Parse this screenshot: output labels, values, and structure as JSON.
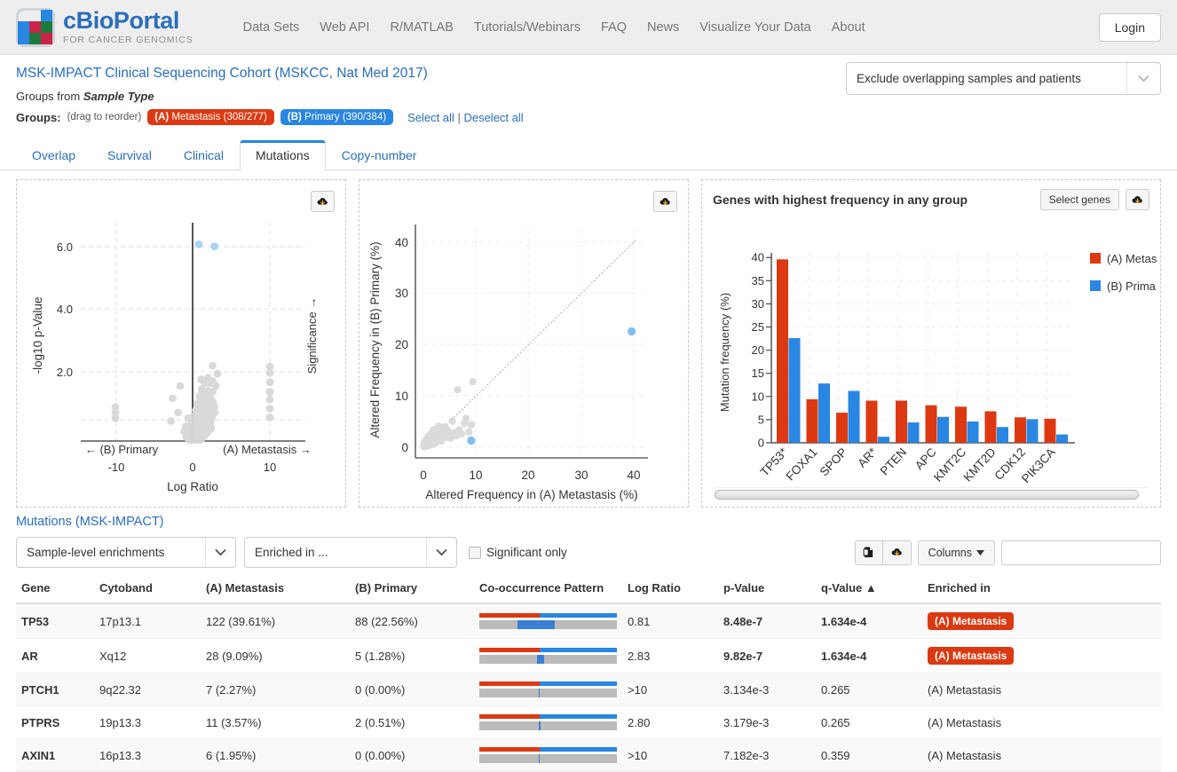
{
  "nav": {
    "logo_title": "cBioPortal",
    "logo_sub": "FOR CANCER GENOMICS",
    "links": [
      "Data Sets",
      "Web API",
      "R/MATLAB",
      "Tutorials/Webinars",
      "FAQ",
      "News",
      "Visualize Your Data",
      "About"
    ],
    "login_label": "Login"
  },
  "study": {
    "title": "MSK-IMPACT Clinical Sequencing Cohort (MSKCC, Nat Med 2017)",
    "groups_from_prefix": "Groups from ",
    "groups_from_attr": "Sample Type",
    "groups_label": "Groups:",
    "drag_hint": "(drag to reorder)",
    "group_a": "(A) Metastasis (308/277)",
    "group_a_prefix": "(A)",
    "group_a_rest": " Metastasis (308/277)",
    "group_b_prefix": "(B)",
    "group_b_rest": " Primary (390/384)",
    "select_all": "Select all",
    "separator": "|",
    "deselect_all": "Deselect all",
    "cohort_select_value": "Exclude overlapping samples and patients"
  },
  "tabs": [
    {
      "label": "Overlap",
      "active": false
    },
    {
      "label": "Survival",
      "active": false
    },
    {
      "label": "Clinical",
      "active": false
    },
    {
      "label": "Mutations",
      "active": true
    },
    {
      "label": "Copy-number",
      "active": false
    }
  ],
  "panels": {
    "bar_title": "Genes with highest frequency in any group",
    "select_genes_label": "Select genes"
  },
  "chart_data": [
    {
      "type": "scatter",
      "name": "volcano-plot",
      "title": "",
      "xlabel": "Log Ratio",
      "ylabel": "-log10 p-Value",
      "ylabel_right": "Significance →",
      "xaxis_left_label": "← (B) Primary",
      "xaxis_right_label": "(A) Metastasis →",
      "xticks": [
        -10,
        0,
        10
      ],
      "xticklabels": [
        "-10",
        "0",
        "10"
      ],
      "yticks": [
        2.0,
        4.0,
        6.0
      ],
      "yticklabels": [
        "2.0",
        "4.0",
        "6.0"
      ],
      "xlim": [
        -15,
        15
      ],
      "ylim": [
        0,
        7
      ],
      "grid": true,
      "highlight_color": "#a8d4f5",
      "point_color": "#d8d8d8",
      "highlighted_points": [
        {
          "x": 0.81,
          "y": 6.07
        },
        {
          "x": 2.83,
          "y": 6.01
        }
      ],
      "points": [
        {
          "x": -10,
          "y": 1.05
        },
        {
          "x": -10,
          "y": 0.88
        },
        {
          "x": -10,
          "y": 0.7
        },
        {
          "x": 10,
          "y": 2.3
        },
        {
          "x": 10,
          "y": 2.1
        },
        {
          "x": 10,
          "y": 1.82
        },
        {
          "x": 10,
          "y": 1.52
        },
        {
          "x": 10,
          "y": 1.5
        },
        {
          "x": 10,
          "y": 1.28
        },
        {
          "x": 10,
          "y": 1.0
        },
        {
          "x": 10,
          "y": 0.73
        },
        {
          "x": 2.6,
          "y": 2.33
        },
        {
          "x": 3.2,
          "y": 2.08
        },
        {
          "x": 2.0,
          "y": 1.95
        },
        {
          "x": 1.1,
          "y": 1.9
        },
        {
          "x": 2.6,
          "y": 1.85
        },
        {
          "x": 1.6,
          "y": 1.8
        },
        {
          "x": 2.2,
          "y": 1.78
        },
        {
          "x": 3.0,
          "y": 1.7
        },
        {
          "x": -1.6,
          "y": 1.7
        },
        {
          "x": 1.2,
          "y": 1.6
        },
        {
          "x": 2.0,
          "y": 1.55
        },
        {
          "x": 2.6,
          "y": 1.52
        },
        {
          "x": 1.5,
          "y": 1.45
        },
        {
          "x": 0.9,
          "y": 1.4
        },
        {
          "x": 2.3,
          "y": 1.37
        },
        {
          "x": -2.6,
          "y": 1.32
        },
        {
          "x": 1.0,
          "y": 1.28
        },
        {
          "x": 1.9,
          "y": 1.25
        },
        {
          "x": 2.6,
          "y": 1.22
        },
        {
          "x": 1.4,
          "y": 1.18
        },
        {
          "x": 0.6,
          "y": 1.15
        },
        {
          "x": 2.1,
          "y": 1.12
        },
        {
          "x": 2.8,
          "y": 1.08
        },
        {
          "x": 1.0,
          "y": 1.05
        },
        {
          "x": 1.7,
          "y": 1.02
        },
        {
          "x": 2.4,
          "y": 0.98
        },
        {
          "x": 0.4,
          "y": 0.95
        },
        {
          "x": 1.2,
          "y": 0.92
        },
        {
          "x": 2.0,
          "y": 0.9
        },
        {
          "x": 2.9,
          "y": 0.88
        },
        {
          "x": -1.9,
          "y": 0.88
        },
        {
          "x": 0.8,
          "y": 0.85
        },
        {
          "x": 1.5,
          "y": 0.82
        },
        {
          "x": 2.3,
          "y": 0.8
        },
        {
          "x": 0.2,
          "y": 0.78
        },
        {
          "x": 1.0,
          "y": 0.75
        },
        {
          "x": 1.8,
          "y": 0.73
        },
        {
          "x": 2.5,
          "y": 0.7
        },
        {
          "x": -0.6,
          "y": 0.7
        },
        {
          "x": 0.5,
          "y": 0.67
        },
        {
          "x": 1.3,
          "y": 0.65
        },
        {
          "x": 2.0,
          "y": 0.62
        },
        {
          "x": -2.8,
          "y": 0.62
        },
        {
          "x": 0.1,
          "y": 0.6
        },
        {
          "x": 0.9,
          "y": 0.58
        },
        {
          "x": 1.6,
          "y": 0.56
        },
        {
          "x": 2.3,
          "y": 0.54
        },
        {
          "x": -0.3,
          "y": 0.52
        },
        {
          "x": 0.6,
          "y": 0.5
        },
        {
          "x": 1.2,
          "y": 0.48
        },
        {
          "x": 1.9,
          "y": 0.46
        },
        {
          "x": -0.9,
          "y": 0.45
        },
        {
          "x": 0.3,
          "y": 0.43
        },
        {
          "x": 1.0,
          "y": 0.41
        },
        {
          "x": 1.7,
          "y": 0.4
        },
        {
          "x": 2.4,
          "y": 0.38
        },
        {
          "x": -0.5,
          "y": 0.37
        },
        {
          "x": 0.2,
          "y": 0.35
        },
        {
          "x": 0.8,
          "y": 0.33
        },
        {
          "x": 1.4,
          "y": 0.32
        },
        {
          "x": 2.0,
          "y": 0.3
        },
        {
          "x": -1.1,
          "y": 0.3
        },
        {
          "x": -0.2,
          "y": 0.28
        },
        {
          "x": 0.5,
          "y": 0.26
        },
        {
          "x": 1.1,
          "y": 0.25
        },
        {
          "x": 1.8,
          "y": 0.24
        },
        {
          "x": -0.7,
          "y": 0.22
        },
        {
          "x": 0.1,
          "y": 0.21
        },
        {
          "x": 0.7,
          "y": 0.2
        },
        {
          "x": 1.3,
          "y": 0.19
        },
        {
          "x": -0.4,
          "y": 0.18
        },
        {
          "x": 0.3,
          "y": 0.17
        },
        {
          "x": 0.9,
          "y": 0.16
        },
        {
          "x": 1.5,
          "y": 0.15
        },
        {
          "x": -0.1,
          "y": 0.14
        },
        {
          "x": 0.5,
          "y": 0.13
        },
        {
          "x": 1.0,
          "y": 0.12
        },
        {
          "x": -0.8,
          "y": 0.12
        },
        {
          "x": 0.2,
          "y": 0.1
        },
        {
          "x": 0.7,
          "y": 0.09
        },
        {
          "x": 1.2,
          "y": 0.08
        },
        {
          "x": -0.3,
          "y": 0.08
        },
        {
          "x": 0.4,
          "y": 0.06
        },
        {
          "x": 0.9,
          "y": 0.05
        },
        {
          "x": 0.0,
          "y": 0.05
        },
        {
          "x": 0.6,
          "y": 0.04
        },
        {
          "x": -0.5,
          "y": 0.04
        },
        {
          "x": 0.3,
          "y": 0.03
        },
        {
          "x": 1.0,
          "y": 0.03
        },
        {
          "x": -0.2,
          "y": 0.02
        }
      ]
    },
    {
      "type": "scatter",
      "name": "frequency-scatter-plot",
      "title": "",
      "xlabel": "Altered Frequency in (A) Metastasis (%)",
      "ylabel": "Altered Frequency in (B) Primary (%)",
      "xticks": [
        0,
        10,
        20,
        30,
        40
      ],
      "xticklabels": [
        "0",
        "10",
        "20",
        "30",
        "40"
      ],
      "yticks": [
        0,
        10,
        20,
        30,
        40
      ],
      "yticklabels": [
        "0",
        "10",
        "20",
        "30",
        "40"
      ],
      "xlim": [
        -1,
        44
      ],
      "ylim": [
        -1.5,
        43
      ],
      "grid": true,
      "diagonal": true,
      "highlight_color": "#7fbdf0",
      "point_color": "#d8d8d8",
      "highlighted_points": [
        {
          "x": 39.6,
          "y": 22.6
        },
        {
          "x": 9.1,
          "y": 1.3
        }
      ],
      "points": [
        {
          "x": 9.4,
          "y": 12.8
        },
        {
          "x": 6.5,
          "y": 11.2
        },
        {
          "x": 9.1,
          "y": 4.4
        },
        {
          "x": 8.1,
          "y": 5.6
        },
        {
          "x": 7.8,
          "y": 4.6
        },
        {
          "x": 6.8,
          "y": 3.4
        },
        {
          "x": 5.5,
          "y": 5.1
        },
        {
          "x": 5.2,
          "y": 1.8
        },
        {
          "x": 4.6,
          "y": 3.3
        },
        {
          "x": 4.1,
          "y": 4.0
        },
        {
          "x": 3.8,
          "y": 2.9
        },
        {
          "x": 3.5,
          "y": 3.6
        },
        {
          "x": 3.2,
          "y": 2.4
        },
        {
          "x": 3.0,
          "y": 3.1
        },
        {
          "x": 2.8,
          "y": 2.0
        },
        {
          "x": 2.6,
          "y": 2.6
        },
        {
          "x": 2.4,
          "y": 1.7
        },
        {
          "x": 2.2,
          "y": 2.2
        },
        {
          "x": 2.0,
          "y": 1.5
        },
        {
          "x": 1.9,
          "y": 2.0
        },
        {
          "x": 1.8,
          "y": 1.3
        },
        {
          "x": 1.7,
          "y": 1.8
        },
        {
          "x": 1.6,
          "y": 1.1
        },
        {
          "x": 1.5,
          "y": 1.6
        },
        {
          "x": 1.4,
          "y": 1.0
        },
        {
          "x": 1.3,
          "y": 1.4
        },
        {
          "x": 1.2,
          "y": 0.9
        },
        {
          "x": 1.1,
          "y": 1.2
        },
        {
          "x": 1.0,
          "y": 0.8
        },
        {
          "x": 0.9,
          "y": 1.1
        },
        {
          "x": 0.8,
          "y": 0.7
        },
        {
          "x": 0.7,
          "y": 1.0
        },
        {
          "x": 0.6,
          "y": 0.6
        },
        {
          "x": 0.5,
          "y": 0.9
        },
        {
          "x": 0.4,
          "y": 0.5
        },
        {
          "x": 0.3,
          "y": 0.8
        },
        {
          "x": 0.3,
          "y": 0.3
        },
        {
          "x": 0.2,
          "y": 0.6
        },
        {
          "x": 0.2,
          "y": 0.2
        },
        {
          "x": 0.1,
          "y": 0.4
        },
        {
          "x": 0.1,
          "y": 0.1
        },
        {
          "x": 0.5,
          "y": 0.2
        },
        {
          "x": 0.8,
          "y": 0.3
        },
        {
          "x": 1.2,
          "y": 0.4
        },
        {
          "x": 1.5,
          "y": 0.5
        },
        {
          "x": 2.1,
          "y": 0.7
        },
        {
          "x": 2.5,
          "y": 1.0
        },
        {
          "x": 3.4,
          "y": 1.2
        },
        {
          "x": 4.4,
          "y": 1.9
        },
        {
          "x": 4.9,
          "y": 2.3
        },
        {
          "x": 2.9,
          "y": 4.1
        },
        {
          "x": 1.9,
          "y": 3.4
        },
        {
          "x": 1.4,
          "y": 2.6
        },
        {
          "x": 0.9,
          "y": 2.1
        },
        {
          "x": 0.6,
          "y": 1.5
        },
        {
          "x": 0.4,
          "y": 1.2
        },
        {
          "x": 5.8,
          "y": 2.8
        },
        {
          "x": 6.2,
          "y": 2.2
        },
        {
          "x": 7.2,
          "y": 2.6
        },
        {
          "x": 8.6,
          "y": 3.0
        },
        {
          "x": 0.2,
          "y": 1.0
        },
        {
          "x": 0.15,
          "y": 0.7
        },
        {
          "x": 0.05,
          "y": 0.35
        }
      ]
    },
    {
      "type": "bar",
      "name": "gene-frequency-bar-chart",
      "title": "Genes with highest frequency in any group",
      "xlabel": "",
      "ylabel": "Mutation frequency (%)",
      "categories": [
        "TP53*",
        "FOXA1",
        "SPOP",
        "AR*",
        "PTEN",
        "APC",
        "KMT2C",
        "KMT2D",
        "CDK12",
        "PIK3CA"
      ],
      "yticks": [
        0,
        5,
        10,
        15,
        20,
        25,
        30,
        35,
        40
      ],
      "yticklabels": [
        "0",
        "5",
        "10",
        "15",
        "20",
        "25",
        "30",
        "35",
        "40"
      ],
      "ylim": [
        0,
        41
      ],
      "grid": true,
      "legend_position": "right",
      "series": [
        {
          "name": "(A) Metas",
          "color": "#dc3912",
          "values": [
            39.6,
            9.4,
            6.5,
            9.1,
            9.1,
            8.1,
            7.8,
            6.8,
            5.5,
            5.2
          ]
        },
        {
          "name": "(B) Prima",
          "color": "#2986e2",
          "values": [
            22.6,
            12.8,
            11.2,
            1.3,
            4.4,
            5.6,
            4.6,
            3.4,
            5.1,
            1.8
          ]
        }
      ]
    }
  ],
  "table": {
    "title": "Mutations (MSK-IMPACT)",
    "enrichment_select": "Sample-level enrichments",
    "filter_select": "Enriched in ...",
    "significant_only_label": "Significant only",
    "columns_label": "Columns",
    "search_placeholder": "",
    "search_value": "",
    "headers": [
      "Gene",
      "Cytoband",
      "(A) Metastasis",
      "(B) Primary",
      "Co-occurrence Pattern",
      "Log Ratio",
      "p-Value",
      "q-Value ▲",
      "Enriched in"
    ],
    "rows": [
      {
        "gene": "TP53",
        "cytoband": "17p13.1",
        "a_metastasis": "122 (39.61%)",
        "b_primary": "88 (22.56%)",
        "cooc_red_pct": 44,
        "cooc_blue_start_pct": 28,
        "cooc_blue_width_pct": 27,
        "log_ratio": "0.81",
        "p_value": "8.48e-7",
        "q_value": "1.634e-4",
        "enriched_in": "(A) Metastasis",
        "significant": true
      },
      {
        "gene": "AR",
        "cytoband": "Xq12",
        "a_metastasis": "28 (9.09%)",
        "b_primary": "5 (1.28%)",
        "cooc_red_pct": 44,
        "cooc_blue_start_pct": 42,
        "cooc_blue_width_pct": 5,
        "log_ratio": "2.83",
        "p_value": "9.82e-7",
        "q_value": "1.634e-4",
        "enriched_in": "(A) Metastasis",
        "significant": true
      },
      {
        "gene": "PTCH1",
        "cytoband": "9q22.32",
        "a_metastasis": "7 (2.27%)",
        "b_primary": "0 (0.00%)",
        "cooc_red_pct": 44,
        "cooc_blue_start_pct": 43,
        "cooc_blue_width_pct": 1,
        "log_ratio": ">10",
        "p_value": "3.134e-3",
        "q_value": "0.265",
        "enriched_in": "(A) Metastasis",
        "significant": false
      },
      {
        "gene": "PTPRS",
        "cytoband": "19p13.3",
        "a_metastasis": "11 (3.57%)",
        "b_primary": "2 (0.51%)",
        "cooc_red_pct": 44,
        "cooc_blue_start_pct": 43,
        "cooc_blue_width_pct": 1.5,
        "log_ratio": "2.80",
        "p_value": "3.179e-3",
        "q_value": "0.265",
        "enriched_in": "(A) Metastasis",
        "significant": false
      },
      {
        "gene": "AXIN1",
        "cytoband": "16p13.3",
        "a_metastasis": "6 (1.95%)",
        "b_primary": "0 (0.00%)",
        "cooc_red_pct": 44,
        "cooc_blue_start_pct": 43,
        "cooc_blue_width_pct": 1,
        "log_ratio": ">10",
        "p_value": "7.182e-3",
        "q_value": "0.359",
        "enriched_in": "(A) Metastasis",
        "significant": false
      }
    ]
  },
  "colors": {
    "group_a": "#dc3912",
    "group_b": "#2986e2",
    "link": "#2a6ebb",
    "point_gray": "#d8d8d8"
  }
}
